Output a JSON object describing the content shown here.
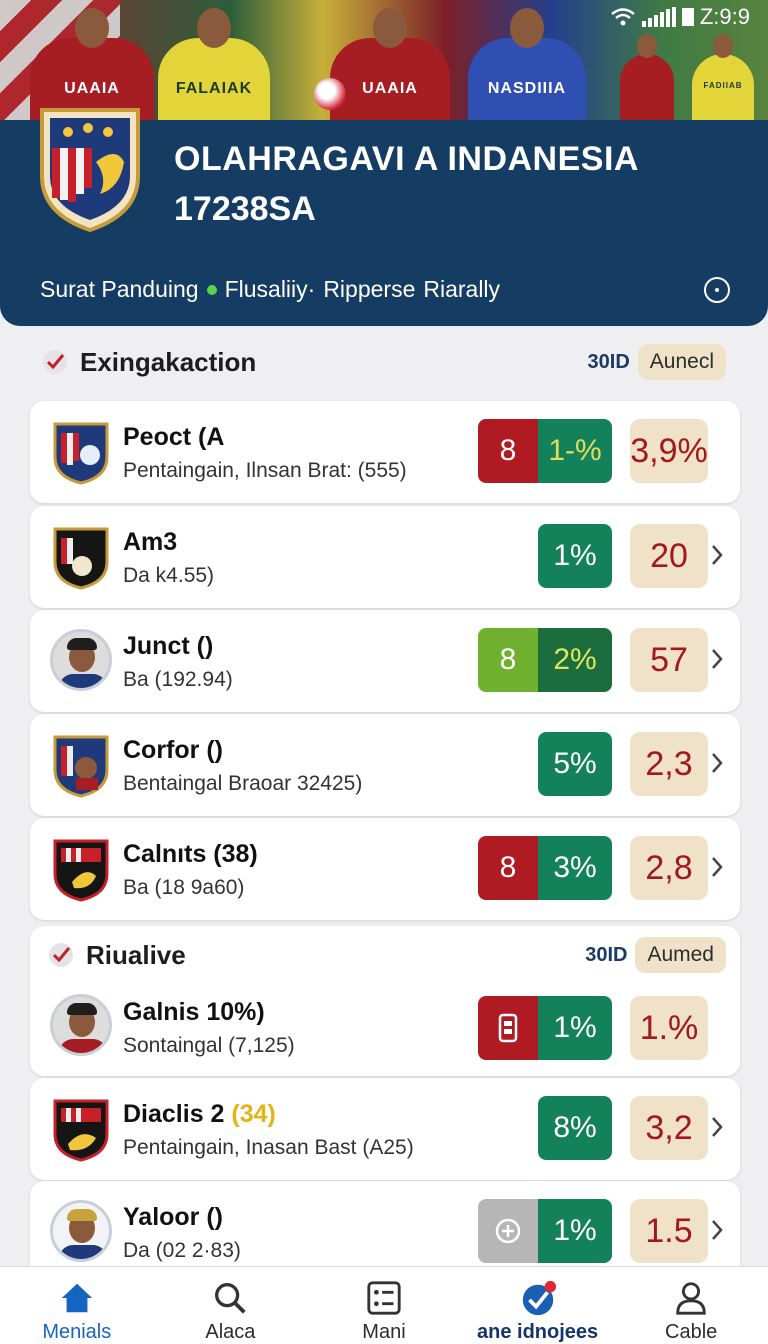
{
  "status_bar": {
    "time": "Z:9:9"
  },
  "header": {
    "jersey_texts": [
      "UAAIA",
      "FALAIAK",
      "UAAIA",
      "NASDIIIA",
      "FADIIAB"
    ],
    "title_line1": "OLAHRAGAVI  A INDANESIA",
    "title_line2": "17238SA",
    "nav_links": [
      "Surat Panduing",
      "Flusaliiy·",
      "Ripperse",
      "Riarally"
    ],
    "icon": "info-icon"
  },
  "sections": [
    {
      "title": "Exingakaction",
      "code": "30ID",
      "pill": "Aunecl",
      "rows": [
        {
          "name": "Peoct (A",
          "sub": "Pentaingain, Ilnsan Brat: (555)",
          "badge_left": "8",
          "badge_right": "1-%",
          "score": "3,9%",
          "logo": "crest"
        },
        {
          "name": "Am3",
          "sub": "Da k4.55)",
          "badge_left": "",
          "badge_right": "1%",
          "score": "20",
          "logo": "crest"
        },
        {
          "name": "Junct ()",
          "sub": "Ba (192.94)",
          "badge_left": "8",
          "badge_right": "2%",
          "score": "57",
          "logo": "avatar"
        },
        {
          "name": "Corfor ()",
          "sub": "Bentaingal Braoar 32425)",
          "badge_left": "",
          "badge_right": "5%",
          "score": "2,3",
          "logo": "crest"
        },
        {
          "name": "Calnıts (38)",
          "sub": "Ba (18 9a60)",
          "badge_left": "8",
          "badge_right": "3%",
          "score": "2,8",
          "logo": "crest"
        }
      ]
    },
    {
      "title": "Riualive",
      "code": "30ID",
      "pill": "Aumed",
      "rows": [
        {
          "name": "Galnis 10%)",
          "sub": "Sontaingal  (7,125)",
          "badge_left": "",
          "badge_right": "1%",
          "score": "1.%",
          "logo": "avatar"
        },
        {
          "name": "Diaclis 2",
          "name_highlight": "(34)",
          "sub": "Pentaingain, Inasan Bast (A25)",
          "badge_left": "",
          "badge_right": "8%",
          "score": "3,2",
          "logo": "crest"
        },
        {
          "name": "Yaloor ()",
          "sub": "Da (02 2·83)",
          "badge_left": "",
          "badge_right": "1%",
          "score": "1.5",
          "logo": "avatar"
        }
      ]
    }
  ],
  "bottom_nav": [
    {
      "label": "Menials",
      "icon": "home-icon",
      "active": true
    },
    {
      "label": "Alaca",
      "icon": "search-icon",
      "active": false
    },
    {
      "label": "Mani",
      "icon": "list-icon",
      "active": false
    },
    {
      "label": "ane idnojees",
      "icon": "check-badge-icon",
      "active": false
    },
    {
      "label": "Cable",
      "icon": "profile-icon",
      "active": false
    }
  ],
  "colors": {
    "header_bg": "#153c63",
    "badge_green": "#13825b",
    "badge_red": "#b01a22",
    "score_bg": "#efe2c8",
    "score_text": "#a3171d",
    "accent_blue": "#1565c0"
  }
}
